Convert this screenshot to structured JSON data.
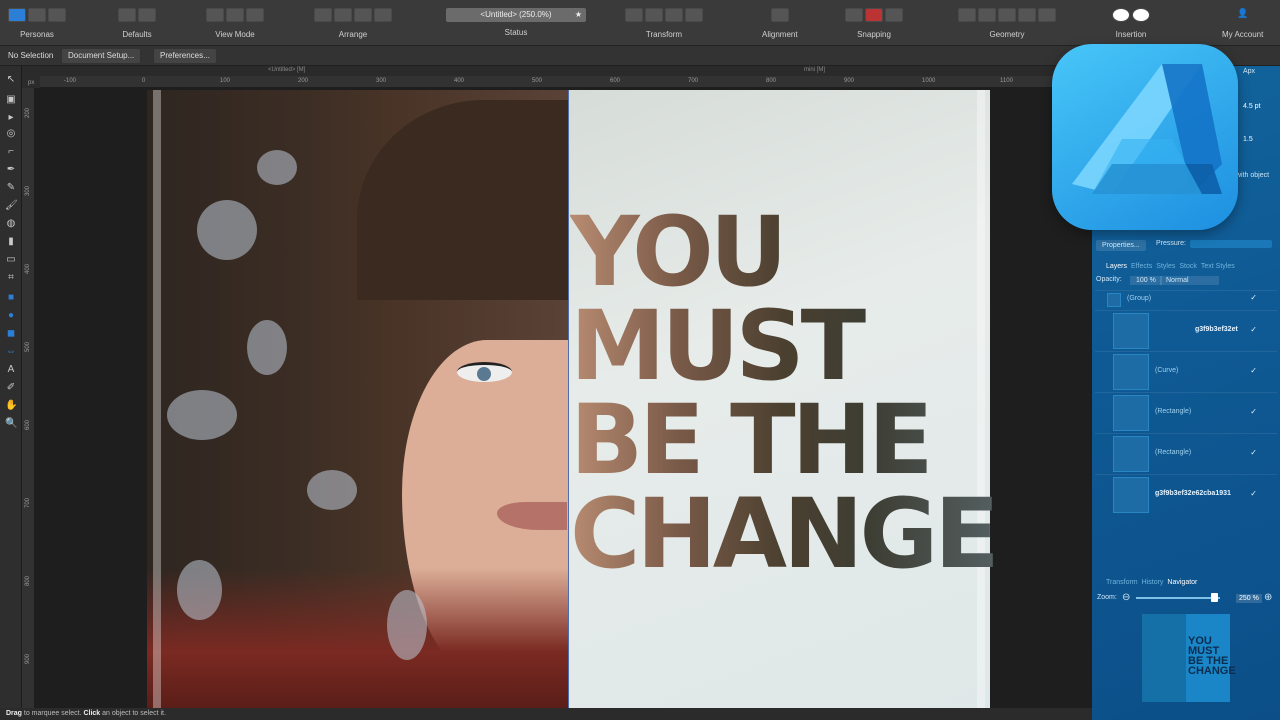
{
  "toolbar": {
    "personas": "Personas",
    "defaults": "Defaults",
    "view_mode": "View Mode",
    "arrange": "Arrange",
    "status_label": "Status",
    "status_value": "<Untitled> (250.0%)",
    "transform": "Transform",
    "alignment": "Alignment",
    "snapping": "Snapping",
    "geometry": "Geometry",
    "insertion": "Insertion",
    "my_account": "My Account"
  },
  "context": {
    "no_selection": "No Selection",
    "document_setup": "Document Setup...",
    "preferences": "Preferences..."
  },
  "tabs": {
    "left": "<Untitled> [M]",
    "right": "mini [M]"
  },
  "ruler_h": [
    "-100",
    "0",
    "100",
    "200",
    "300",
    "400",
    "500",
    "600",
    "700",
    "800",
    "900",
    "1000",
    "1100"
  ],
  "ruler_v": [
    "200",
    "300",
    "400",
    "500",
    "600",
    "700",
    "800",
    "900"
  ],
  "ruler_unit": "px",
  "canvas": {
    "lines": [
      "YOU",
      "MUST",
      "BE THE",
      "CHANGE"
    ]
  },
  "panel": {
    "apx": "Apx",
    "stroke_value": "4.5 pt",
    "ratio_value": "1.5",
    "with_object": "with object",
    "properties": "Properties...",
    "pressure": "Pressure:",
    "layer_tabs": [
      "Layers",
      "Effects",
      "Styles",
      "Stock",
      "Text Styles"
    ],
    "opacity_label": "Opacity:",
    "opacity_value": "100 %",
    "blend_mode": "Normal",
    "layers": [
      {
        "name": "(Group)"
      },
      {
        "name": "g3f9b3ef32et"
      },
      {
        "name": "(Curve)"
      },
      {
        "name": "(Rectangle)"
      },
      {
        "name": "(Rectangle)"
      },
      {
        "name": "g3f9b3ef32e62cba1931"
      }
    ],
    "bottom_tabs": [
      "Transform",
      "History",
      "Navigator"
    ],
    "zoom_label": "Zoom:",
    "zoom_value": "250 %",
    "nav_text": "YOU MUST BE THE CHANGE"
  },
  "statusbar": {
    "drag": "Drag",
    "drag_text": " to marquee select. ",
    "click": "Click",
    "click_text": " an object to select it."
  },
  "colors": {
    "accent": "#1d8fe0",
    "sidebar": "#0f5a95"
  }
}
